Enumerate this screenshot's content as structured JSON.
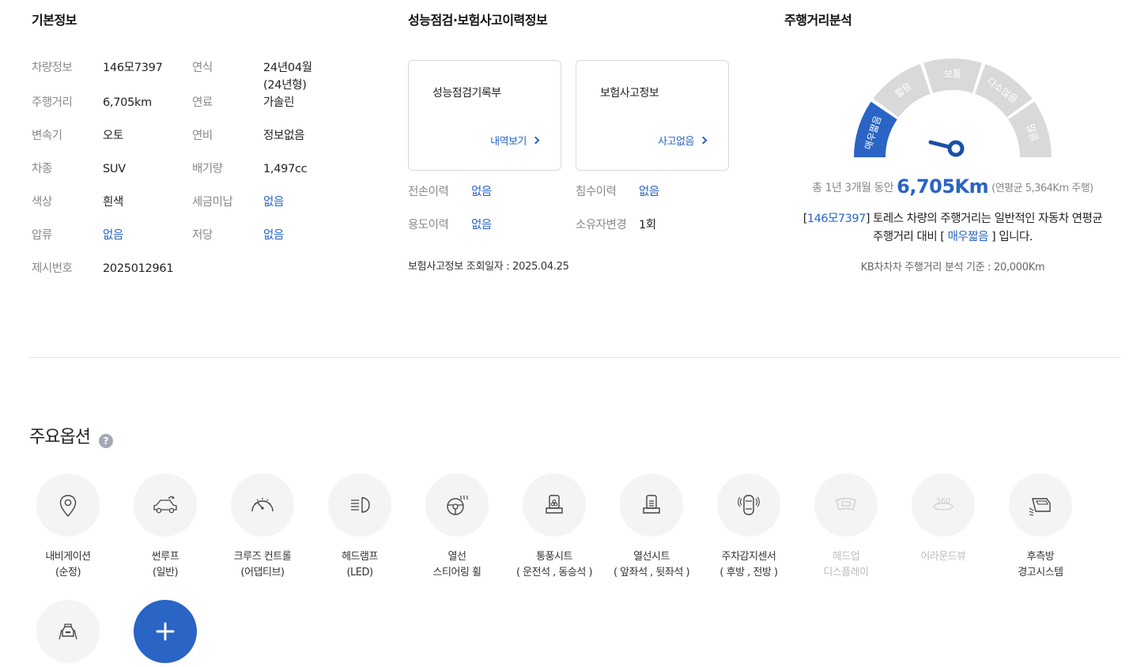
{
  "basic_info": {
    "title": "기본정보",
    "rows": [
      {
        "label1": "차량정보",
        "value1": "146모7397",
        "label2": "연식",
        "value2": "24년04월",
        "value2b": "(24년형)"
      },
      {
        "label1": "주행거리",
        "value1": "6,705km",
        "label2": "연료",
        "value2": "가솔린"
      },
      {
        "label1": "변속기",
        "value1": "오토",
        "label2": "연비",
        "value2": "정보없음"
      },
      {
        "label1": "차종",
        "value1": "SUV",
        "label2": "배기량",
        "value2": "1,497cc"
      },
      {
        "label1": "색상",
        "value1": "흰색",
        "label2": "세금미납",
        "value2": "없음"
      },
      {
        "label1": "압류",
        "value1": "없음",
        "label2": "저당",
        "value2": "없음"
      },
      {
        "label1": "제시번호",
        "value1": "2025012961"
      }
    ]
  },
  "inspection": {
    "title": "성능점검·보험사고이력정보",
    "card1": {
      "title": "성능점검기록부",
      "link": "내역보기"
    },
    "card2": {
      "title": "보험사고정보",
      "link": "사고없음"
    },
    "history": [
      {
        "label": "전손이력",
        "value": "없음"
      },
      {
        "label": "침수이력",
        "value": "없음"
      },
      {
        "label": "용도이력",
        "value": "없음"
      },
      {
        "label": "소유자변경",
        "value": "1회"
      }
    ],
    "lookup_note": "보험사고정보 조회일자 : 2025.04.25"
  },
  "mileage": {
    "title": "주행거리분석",
    "gauge_segments": [
      "매우짧음",
      "짧음",
      "보통",
      "다소많음",
      "많음"
    ],
    "active_segment": "매우짧음",
    "colors": {
      "active": "#2a64c4",
      "inactive": "#d9d9d9",
      "needle": "#1a4fa8"
    },
    "period_prefix": "총 1년 3개월 동안",
    "distance": "6,705Km",
    "annual_avg": "(연평균 5,364Km 주행)",
    "summary_plate": "146모7397",
    "summary_text1": "토레스 차량의 주행거리는 일반적인 자동차 연평균",
    "summary_text2_a": "주행거리 대비 [",
    "summary_text2_level": "매우짧음",
    "summary_text2_b": "] 입니다.",
    "criteria": "KB차차차 주행거리 분석 기준 : 20,000Km"
  },
  "options": {
    "title": "주요옵션",
    "help": "?",
    "items": [
      {
        "line1": "내비게이션",
        "line2": "(순정)",
        "icon": "navigation-pin-icon",
        "enabled": true
      },
      {
        "line1": "썬루프",
        "line2": "(일반)",
        "icon": "sunroof-car-icon",
        "enabled": true
      },
      {
        "line1": "크루즈 컨트롤",
        "line2": "(어댑티브)",
        "icon": "cruise-gauge-icon",
        "enabled": true
      },
      {
        "line1": "헤드램프",
        "line2": "(LED)",
        "icon": "headlamp-icon",
        "enabled": true
      },
      {
        "line1": "열선",
        "line2": "스티어링 휠",
        "icon": "heated-steering-icon",
        "enabled": true
      },
      {
        "line1": "통풍시트",
        "line2": "( 운전석 , 동승석 )",
        "icon": "ventilated-seat-icon",
        "enabled": true
      },
      {
        "line1": "열선시트",
        "line2": "( 앞좌석 , 뒷좌석 )",
        "icon": "heated-seat-icon",
        "enabled": true
      },
      {
        "line1": "주차감지센서",
        "line2": "( 후방 , 전방 )",
        "icon": "parking-sensor-icon",
        "enabled": true
      },
      {
        "line1": "헤드업",
        "line2": "디스플레이",
        "icon": "hud-icon",
        "enabled": false
      },
      {
        "line1": "어라운드뷰",
        "line2": "",
        "icon": "around-view-icon",
        "enabled": false
      },
      {
        "line1": "후측방",
        "line2": "경고시스템",
        "icon": "blind-spot-icon",
        "enabled": true
      },
      {
        "line1": "",
        "line2": "",
        "icon": "lane-car-icon",
        "enabled": true
      }
    ],
    "more": "+"
  }
}
